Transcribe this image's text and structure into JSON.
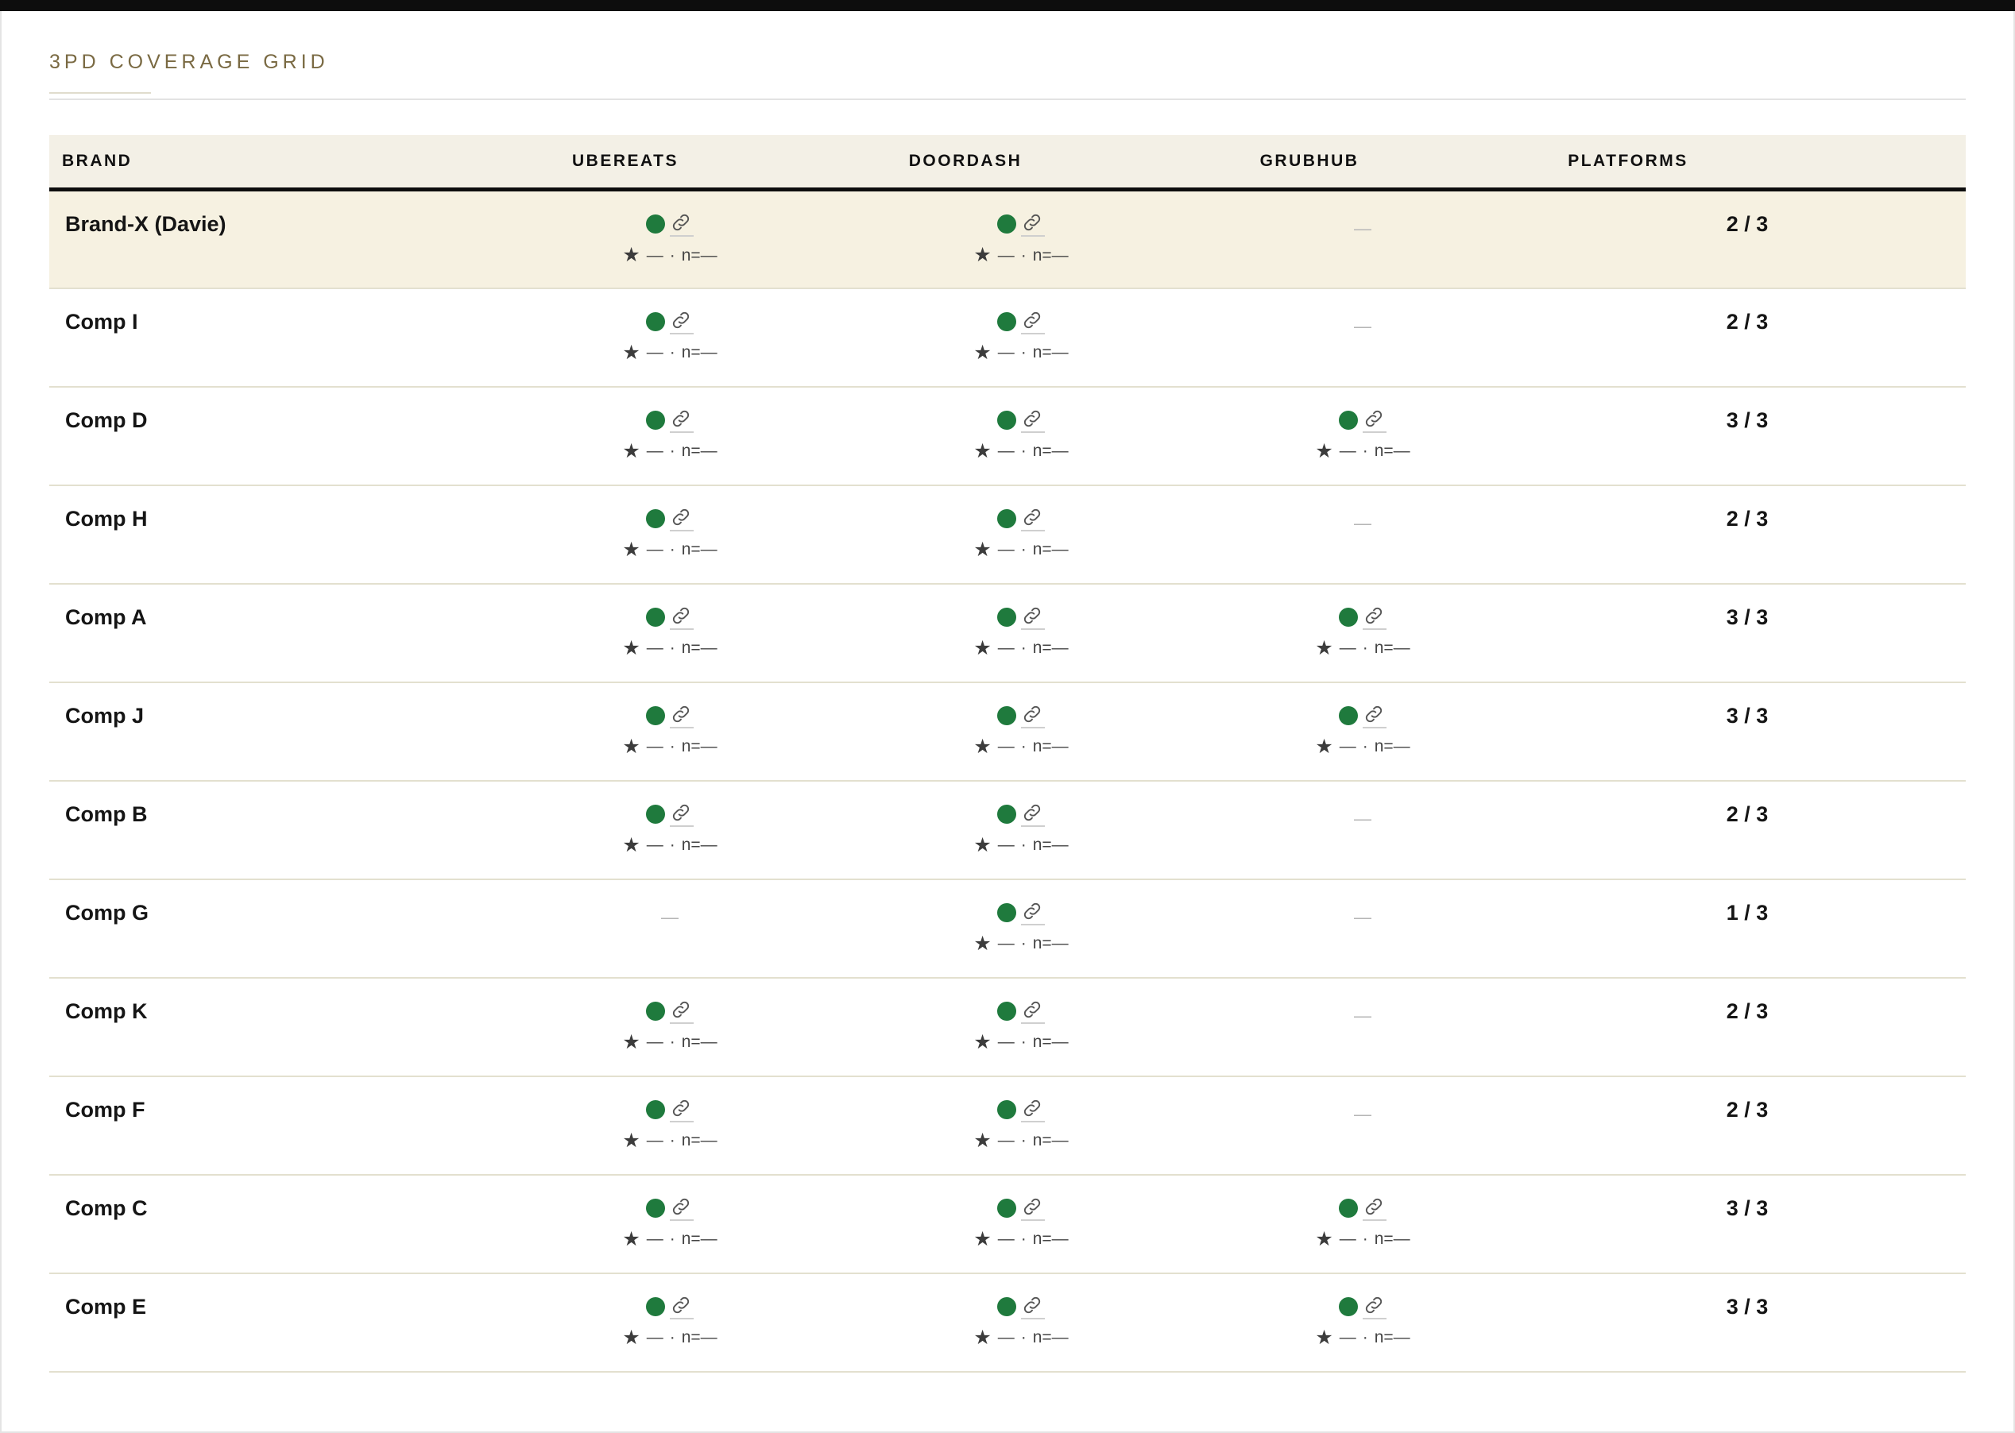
{
  "title": "3PD COVERAGE GRID",
  "columns": {
    "brand": "BRAND",
    "ubereats": "UBEREATS",
    "doordash": "DOORDASH",
    "grubhub": "GRUBHUB",
    "platforms": "PLATFORMS"
  },
  "labels": {
    "rating": "—",
    "sep": "·",
    "count": "n=—",
    "absent": "—"
  },
  "icons": {
    "status": "status-dot-icon",
    "link": "link-icon",
    "rating": "star-icon"
  },
  "colors": {
    "status_active": "#1f7a3d",
    "title": "#7a6a43",
    "highlight_row": "#f6f1e1",
    "header_bg": "#f3f0e6"
  },
  "rows": [
    {
      "brand": "Brand-X (Davie)",
      "highlight": true,
      "ubereats": true,
      "doordash": true,
      "grubhub": false,
      "platforms": "2 / 3"
    },
    {
      "brand": "Comp I",
      "highlight": false,
      "ubereats": true,
      "doordash": true,
      "grubhub": false,
      "platforms": "2 / 3"
    },
    {
      "brand": "Comp D",
      "highlight": false,
      "ubereats": true,
      "doordash": true,
      "grubhub": true,
      "platforms": "3 / 3"
    },
    {
      "brand": "Comp H",
      "highlight": false,
      "ubereats": true,
      "doordash": true,
      "grubhub": false,
      "platforms": "2 / 3"
    },
    {
      "brand": "Comp A",
      "highlight": false,
      "ubereats": true,
      "doordash": true,
      "grubhub": true,
      "platforms": "3 / 3"
    },
    {
      "brand": "Comp J",
      "highlight": false,
      "ubereats": true,
      "doordash": true,
      "grubhub": true,
      "platforms": "3 / 3"
    },
    {
      "brand": "Comp B",
      "highlight": false,
      "ubereats": true,
      "doordash": true,
      "grubhub": false,
      "platforms": "2 / 3"
    },
    {
      "brand": "Comp G",
      "highlight": false,
      "ubereats": false,
      "doordash": true,
      "grubhub": false,
      "platforms": "1 / 3"
    },
    {
      "brand": "Comp K",
      "highlight": false,
      "ubereats": true,
      "doordash": true,
      "grubhub": false,
      "platforms": "2 / 3"
    },
    {
      "brand": "Comp F",
      "highlight": false,
      "ubereats": true,
      "doordash": true,
      "grubhub": false,
      "platforms": "2 / 3"
    },
    {
      "brand": "Comp C",
      "highlight": false,
      "ubereats": true,
      "doordash": true,
      "grubhub": true,
      "platforms": "3 / 3"
    },
    {
      "brand": "Comp E",
      "highlight": false,
      "ubereats": true,
      "doordash": true,
      "grubhub": true,
      "platforms": "3 / 3"
    }
  ]
}
